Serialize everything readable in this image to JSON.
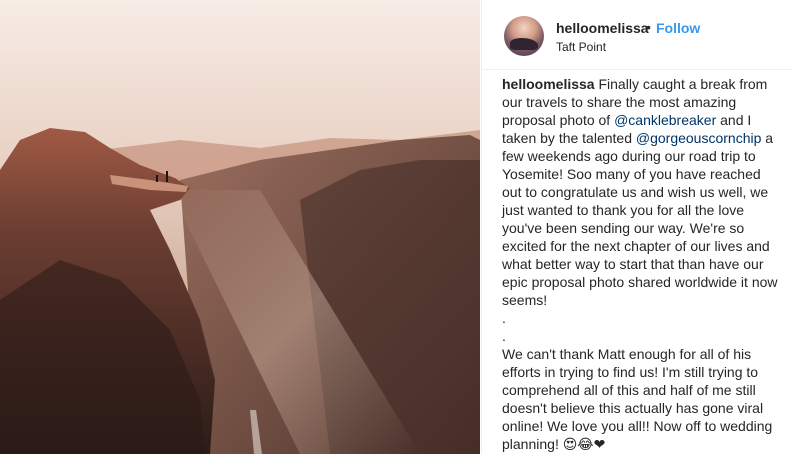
{
  "post": {
    "username": "helloomelissa",
    "separator": "•",
    "follow_label": "Follow",
    "location": "Taft Point"
  },
  "caption": {
    "username": "helloomelissa",
    "part1": " Finally caught a break from our travels to share the most amazing proposal photo of ",
    "mention1": "@canklebreaker",
    "part2": " and I taken by the talented ",
    "mention2": "@gorgeouscornchip",
    "part3": " a few weekends ago during our road trip to Yosemite! Soo many of you have reached out to congratulate us and wish us well, we just wanted to thank you for all the love you've been sending our way. We're so excited for the next chapter of our lives and what better way to start that than have our epic proposal photo shared worldwide it now seems!\n.\n.\nWe can't thank Matt enough for all of his efforts in trying to find us! I'm still trying to comprehend all of this and half of me still doesn't believe this actually has gone viral online! We love you all!! Now off to wedding planning! 😍😂❤"
  },
  "photo": {
    "icon": "cliff-proposal-photo",
    "sky_color": "#f4e6dc",
    "rock_color": "#5a3a30"
  }
}
